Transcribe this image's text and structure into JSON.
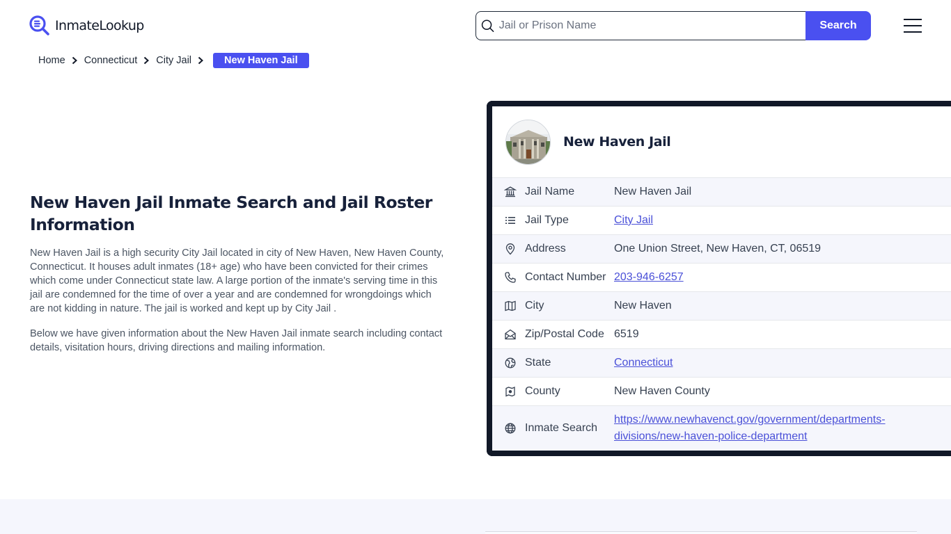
{
  "header": {
    "logo_text": "InmateLookup",
    "search_placeholder": "Jail or Prison Name",
    "search_button": "Search",
    "accent_color": "#4a50f0"
  },
  "breadcrumb": {
    "items": [
      "Home",
      "Connecticut",
      "City Jail"
    ],
    "current": "New Haven Jail"
  },
  "intro": {
    "title": "New Haven Jail Inmate Search and Jail Roster Information",
    "paragraph1": "New Haven Jail is a high security City Jail located in city of New Haven, New Haven County, Connecticut. It houses adult inmates (18+ age) who have been convicted for their crimes which come under Connecticut state law. A large portion of the inmate's serving time in this jail are condemned for the time of over a year and are condemned for wrongdoings which are not kidding in nature. The jail is worked and kept up by City Jail .",
    "paragraph2": "Below we have given information about the New Haven Jail inmate search including contact details, visitation hours, driving directions and mailing information."
  },
  "card": {
    "title": "New Haven Jail",
    "rows": [
      {
        "icon": "bank-icon",
        "label": "Jail Name",
        "value": "New Haven Jail",
        "link": false
      },
      {
        "icon": "list-icon",
        "label": "Jail Type",
        "value": "City Jail",
        "link": true
      },
      {
        "icon": "map-pin-icon",
        "label": "Address",
        "value": "One Union Street, New Haven, CT, 06519",
        "link": false
      },
      {
        "icon": "phone-icon",
        "label": "Contact Number",
        "value": "203-946-6257",
        "link": true
      },
      {
        "icon": "map-icon",
        "label": "City",
        "value": "New Haven",
        "link": false
      },
      {
        "icon": "mail-open-icon",
        "label": "Zip/Postal Code",
        "value": "6519",
        "link": false
      },
      {
        "icon": "globe-pin-icon",
        "label": "State",
        "value": "Connecticut",
        "link": true
      },
      {
        "icon": "map-marker-icon",
        "label": "County",
        "value": "New Haven County",
        "link": false
      },
      {
        "icon": "globe-icon",
        "label": "Inmate Search",
        "value": "https://www.newhavenct.gov/government/departments-divisions/new-haven-police-department",
        "link": true
      }
    ]
  }
}
